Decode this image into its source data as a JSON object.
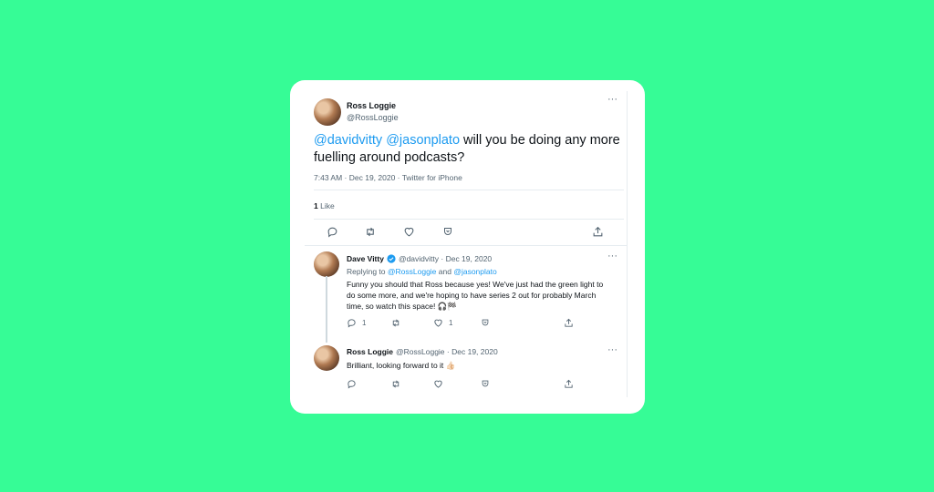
{
  "tweet": {
    "author_name": "Ross Loggie",
    "author_handle": "@RossLoggie",
    "mention1": "@davidvitty",
    "mention2": "@jasonplato",
    "text": " will you be doing any more fuelling around podcasts?",
    "meta": "7:43 AM · Dec 19, 2020 · Twitter for iPhone",
    "likes_count": "1",
    "likes_label": "Like",
    "more": "···"
  },
  "replies": [
    {
      "author_name": "Dave Vitty",
      "author_handle": "@davidvitty",
      "date": "Dec 19, 2020",
      "replying_prefix": "Replying to ",
      "replying_to1": "@RossLoggie",
      "replying_and": " and ",
      "replying_to2": "@jasonplato",
      "text": "Funny you should that Ross because yes! We've just had the green light to do some more, and we're hoping to have series 2 out for probably March time, so watch this space! 🎧🏁",
      "reply_count": "1",
      "like_count": "1",
      "more": "···"
    },
    {
      "author_name": "Ross Loggie",
      "author_handle": "@RossLoggie",
      "date": "Dec 19, 2020",
      "text": "Brilliant, looking forward to it 👍🏻",
      "more": "···"
    }
  ],
  "colors": {
    "background": "#36fc96",
    "accent": "#1d9bf0",
    "secondary_text": "#536471"
  },
  "icons": [
    "reply-icon",
    "retweet-icon",
    "like-icon",
    "bookmark-icon",
    "share-icon",
    "verified-icon",
    "more-icon"
  ]
}
